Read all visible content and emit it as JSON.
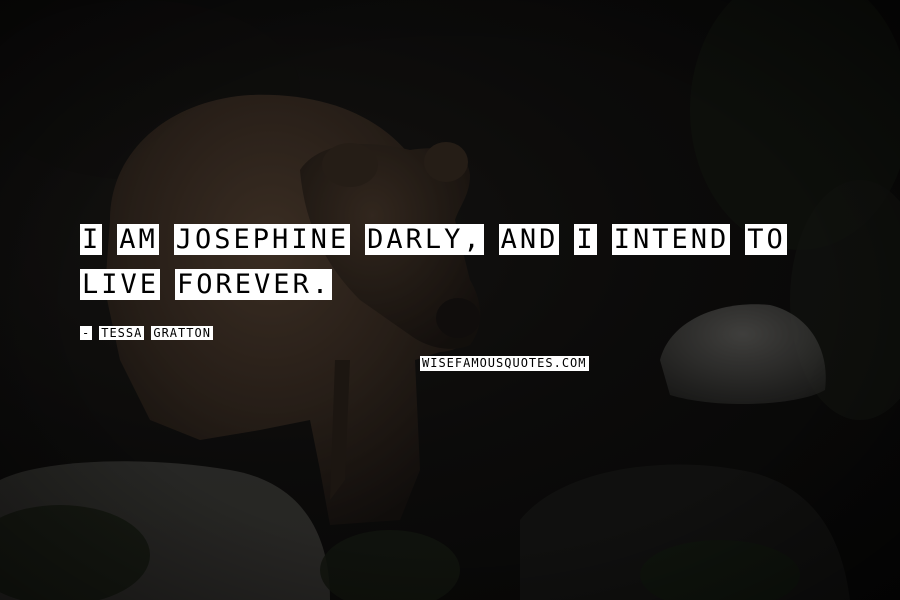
{
  "quote": {
    "words": [
      "I",
      "AM",
      "JOSEPHINE",
      "DARLY,",
      "AND",
      "I",
      "INTEND",
      "TO",
      "LIVE",
      "FOREVER."
    ]
  },
  "author": {
    "dash": "-",
    "first": "TESSA",
    "last": "GRATTON"
  },
  "site": "WISEFAMOUSQUOTES.COM"
}
